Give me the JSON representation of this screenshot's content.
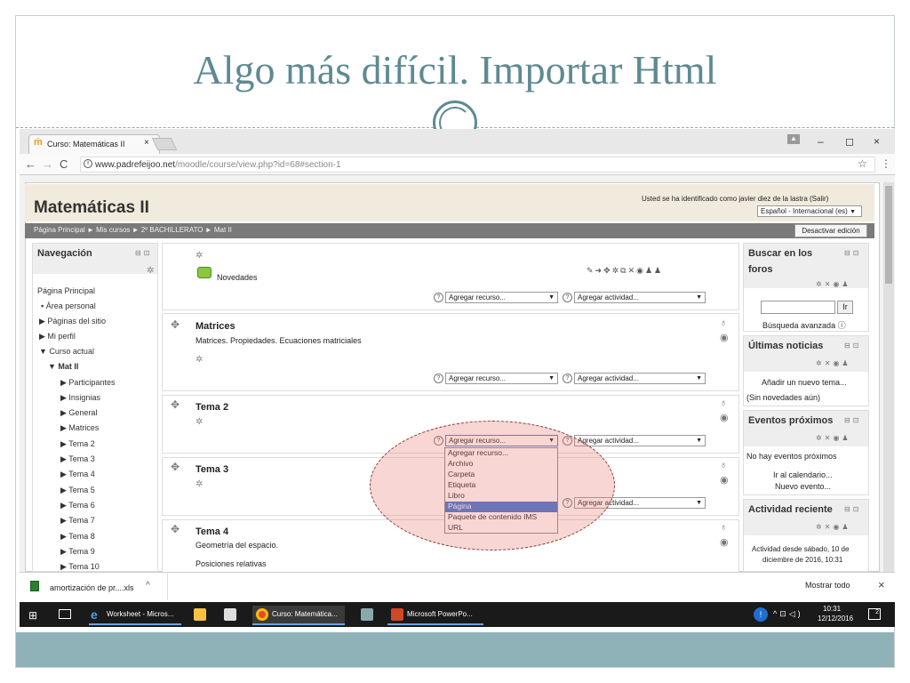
{
  "slide": {
    "title": "Algo más difícil. Importar Html"
  },
  "browser": {
    "tab_title": "Curso: Matemáticas II",
    "tab_close": "×",
    "url_domain": "www.padrefeijoo.net",
    "url_path": "/moodle/course/view.php?id=68#section-1",
    "win_min": "–",
    "win_max": "◻",
    "win_close": "×"
  },
  "course": {
    "title": "Matemáticas II",
    "login_text": "Usted se ha identificado como javier diez de la lastra (Salir)",
    "language": "Español - Internacional (es)",
    "breadcrumb": "Página Principal ► Mis cursos ► 2º BACHILLERATO ► Mat II",
    "edit_button": "Desactivar edición"
  },
  "nav": {
    "title": "Navegación",
    "items": [
      "Página Principal",
      "Área personal",
      "Páginas del sitio",
      "Mi perfil",
      "Curso actual",
      "Mat II",
      "Participantes",
      "Insignias",
      "General",
      "Matrices",
      "Tema 2",
      "Tema 3",
      "Tema 4",
      "Tema 5",
      "Tema 6",
      "Tema 7",
      "Tema 8",
      "Tema 9",
      "Tema 10"
    ]
  },
  "sections": {
    "general_forum": "Novedades",
    "add_resource": "Agregar recurso...",
    "add_activity": "Agregar actividad...",
    "matrices_title": "Matrices",
    "matrices_desc": "Matrices. Propiedades. Ecuaciones matriciales",
    "tema2_title": "Tema 2",
    "tema3_title": "Tema 3",
    "tema4_title": "Tema 4",
    "tema4_line1": "Geometría del espacio.",
    "tema4_line2": "Posiciones relativas"
  },
  "dropdown": {
    "items": [
      "Agregar recurso...",
      "Archivo",
      "Carpeta",
      "Etiqueta",
      "Libro",
      "Página",
      "Paquete de contenido IMS",
      "URL"
    ],
    "selected": "Página"
  },
  "right_blocks": {
    "search_title_1": "Buscar en los",
    "search_title_2": "foros",
    "search_button": "Ir",
    "advanced_search": "Búsqueda avanzada",
    "news_title": "Últimas noticias",
    "news_add": "Añadir un nuevo tema...",
    "news_none": "(Sin novedades aún)",
    "events_title": "Eventos próximos",
    "events_none": "No hay eventos próximos",
    "events_calendar": "Ir al calendario...",
    "events_new": "Nuevo evento...",
    "activity_title": "Actividad reciente",
    "activity_since_1": "Actividad desde sábado, 10 de",
    "activity_since_2": "diciembre de 2016, 10:31"
  },
  "download_bar": {
    "file": "amortización de pr....xls",
    "show_all": "Mostrar todo",
    "close": "×"
  },
  "taskbar": {
    "items": [
      "Worksheet - Micros...",
      "Curso: Matemática...",
      "Microsoft PowerPo..."
    ],
    "time": "10:31",
    "date": "12/12/2016",
    "notif_count": "2"
  },
  "colors": {
    "title_teal": "#5e8a92",
    "moodle_header": "#f0ebdc",
    "breadcrumb_bar": "#7a7a7a",
    "dropdown_highlight": "#3875d7",
    "annotation_oval": "#e6786e"
  }
}
